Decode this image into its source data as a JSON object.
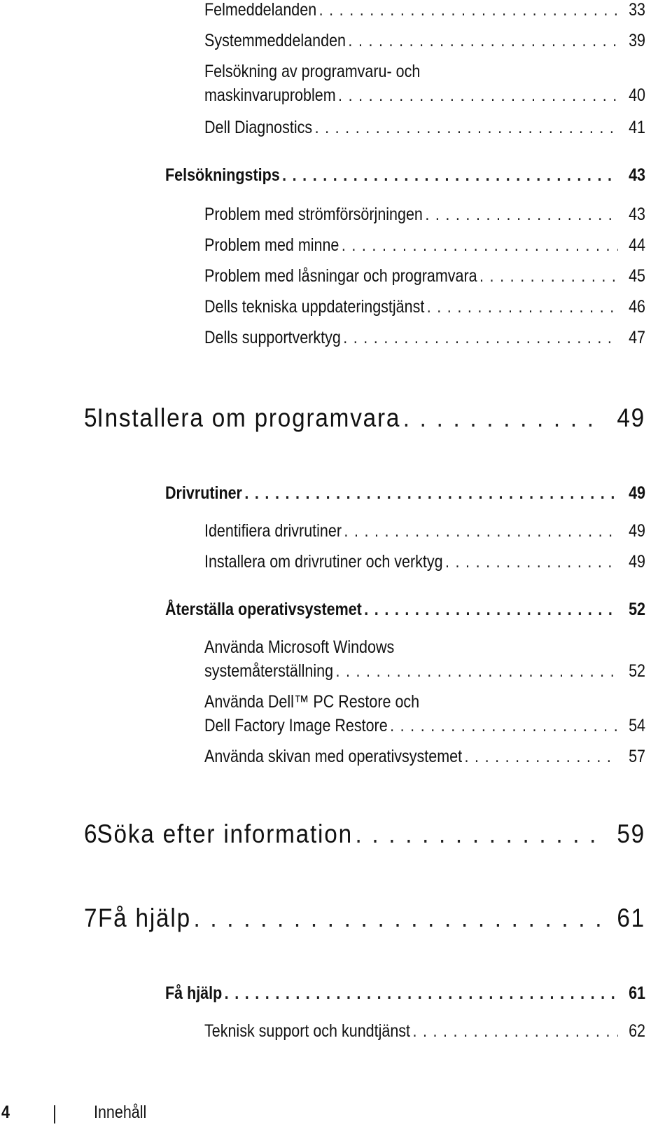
{
  "toc": {
    "entries": [
      {
        "level": "sub",
        "title": "Felmeddelanden",
        "page": "33"
      },
      {
        "level": "sub",
        "title": "Systemmeddelanden",
        "page": "39"
      },
      {
        "level": "sub",
        "title_line1": "Felsökning av programvaru- och",
        "title": "maskinvaruproblem",
        "page": "40"
      },
      {
        "level": "sub",
        "title": "Dell Diagnostics",
        "page": "41"
      },
      {
        "level": "section",
        "title": "Felsökningstips",
        "page": "43"
      },
      {
        "level": "sub",
        "title": "Problem med strömförsörjningen",
        "page": "43"
      },
      {
        "level": "sub",
        "title": "Problem med minne",
        "page": "44"
      },
      {
        "level": "sub",
        "title": "Problem med låsningar och programvara",
        "page": "45"
      },
      {
        "level": "sub",
        "title": "Dells tekniska uppdateringstjänst",
        "page": "46"
      },
      {
        "level": "sub",
        "title": "Dells supportverktyg",
        "page": "47"
      },
      {
        "level": "chapter",
        "number": "5",
        "title": "Installera om programvara",
        "page": "49"
      },
      {
        "level": "section",
        "title": "Drivrutiner",
        "page": "49"
      },
      {
        "level": "sub",
        "title": "Identifiera drivrutiner",
        "page": "49"
      },
      {
        "level": "sub",
        "title": "Installera om drivrutiner och verktyg",
        "page": "49"
      },
      {
        "level": "section",
        "title": "Återställa operativsystemet",
        "page": "52"
      },
      {
        "level": "sub",
        "title_line1": "Använda Microsoft Windows",
        "title": "systemåterställning",
        "page": "52"
      },
      {
        "level": "sub",
        "title_line1": "Använda Dell™ PC Restore och",
        "title": "Dell Factory Image Restore",
        "page": "54"
      },
      {
        "level": "sub",
        "title": "Använda skivan med operativsystemet",
        "page": "57"
      },
      {
        "level": "chapter",
        "number": "6",
        "title": "Söka efter information",
        "page": "59"
      },
      {
        "level": "chapter",
        "number": "7",
        "title": "Få hjälp",
        "page": "61"
      },
      {
        "level": "section",
        "title": "Få hjälp",
        "page": "61"
      },
      {
        "level": "sub",
        "title": "Teknisk support och kundtjänst",
        "page": "62"
      }
    ]
  },
  "footer": {
    "page_number": "4",
    "section_label": "Innehåll"
  }
}
